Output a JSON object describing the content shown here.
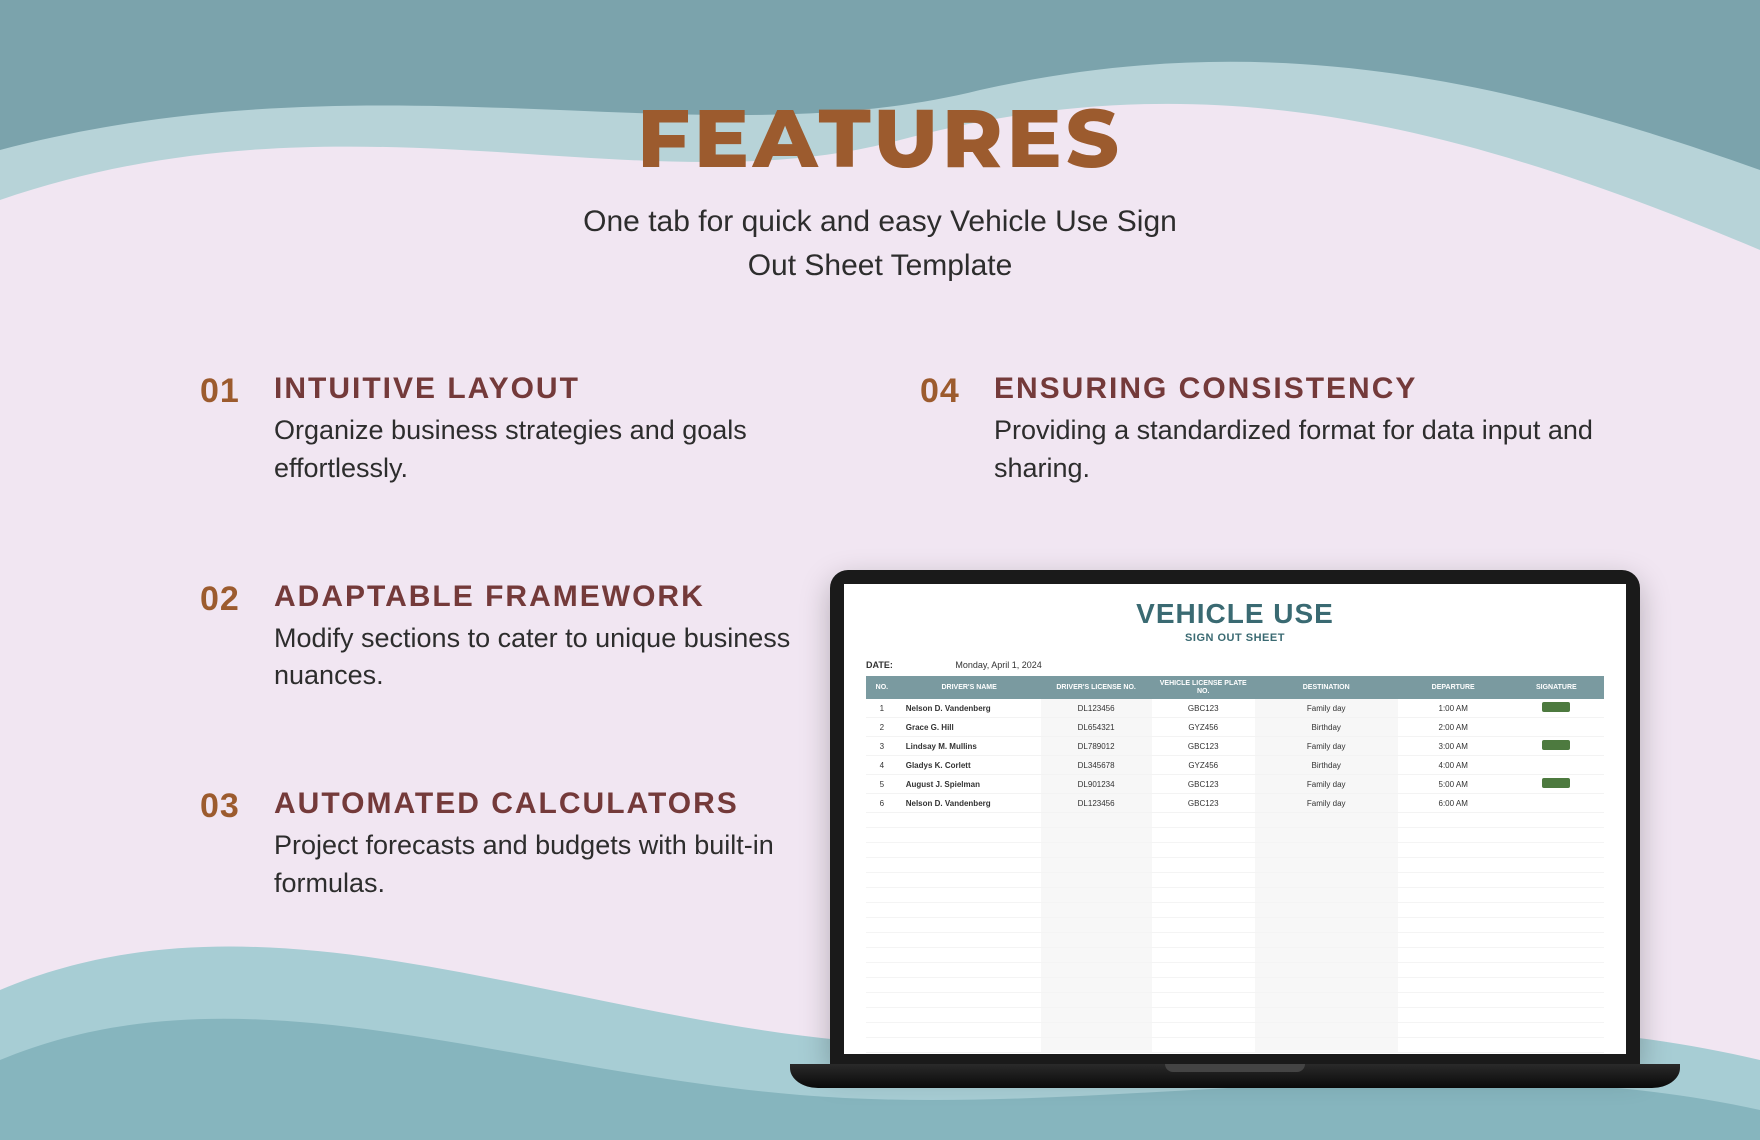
{
  "header": {
    "title": "FEATURES",
    "subtitle_line1": "One tab for quick and easy Vehicle Use Sign",
    "subtitle_line2": "Out Sheet Template"
  },
  "features": [
    {
      "num": "01",
      "title": "INTUITIVE LAYOUT",
      "desc": "Organize business strategies and goals effortlessly."
    },
    {
      "num": "02",
      "title": "ADAPTABLE FRAMEWORK",
      "desc": "Modify sections to cater to unique business nuances."
    },
    {
      "num": "03",
      "title": "AUTOMATED CALCULATORS",
      "desc": "Project forecasts and budgets with built-in formulas."
    },
    {
      "num": "04",
      "title": "ENSURING CONSISTENCY",
      "desc": "Providing a standardized format for data input and sharing."
    }
  ],
  "sheet": {
    "title": "VEHICLE USE",
    "subtitle": "SIGN OUT SHEET",
    "date_label": "DATE:",
    "date_value": "Monday, April 1, 2024",
    "headers": {
      "no": "NO.",
      "name": "DRIVER'S NAME",
      "license": "DRIVER'S LICENSE NO.",
      "plate": "VEHICLE LICENSE PLATE NO.",
      "dest": "DESTINATION",
      "departure": "DEPARTURE",
      "signature": "SIGNATURE"
    },
    "rows": [
      {
        "no": "1",
        "name": "Nelson D. Vandenberg",
        "license": "DL123456",
        "plate": "GBC123",
        "dest": "Family day",
        "departure": "1:00 AM",
        "signed": true
      },
      {
        "no": "2",
        "name": "Grace G. Hill",
        "license": "DL654321",
        "plate": "GYZ456",
        "dest": "Birthday",
        "departure": "2:00 AM",
        "signed": false
      },
      {
        "no": "3",
        "name": "Lindsay M. Mullins",
        "license": "DL789012",
        "plate": "GBC123",
        "dest": "Family day",
        "departure": "3:00 AM",
        "signed": true
      },
      {
        "no": "4",
        "name": "Gladys K. Corlett",
        "license": "DL345678",
        "plate": "GYZ456",
        "dest": "Birthday",
        "departure": "4:00 AM",
        "signed": false
      },
      {
        "no": "5",
        "name": "August J. Spielman",
        "license": "DL901234",
        "plate": "GBC123",
        "dest": "Family day",
        "departure": "5:00 AM",
        "signed": true
      },
      {
        "no": "6",
        "name": "Nelson D. Vandenberg",
        "license": "DL123456",
        "plate": "GBC123",
        "dest": "Family day",
        "departure": "6:00 AM",
        "signed": false
      }
    ]
  }
}
